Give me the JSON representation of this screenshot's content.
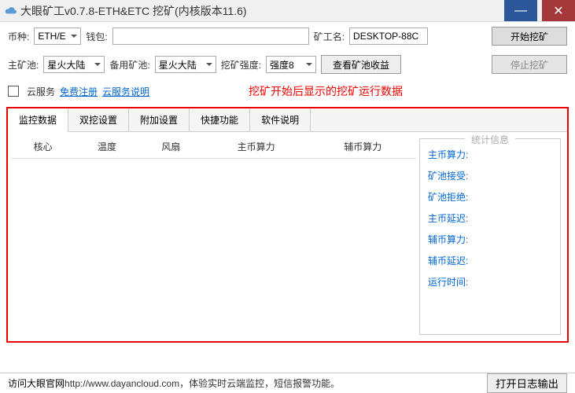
{
  "titlebar": {
    "title": "大眼矿工v0.7.8-ETH&ETC 挖矿(内核版本11.6)"
  },
  "row1": {
    "coin_label": "币种:",
    "coin_value": "ETH/E",
    "wallet_label": "钱包:",
    "wallet_value": "",
    "miner_label": "矿工名:",
    "miner_value": "DESKTOP-88C",
    "start_btn": "开始挖矿"
  },
  "row2": {
    "main_pool_label": "主矿池:",
    "main_pool_value": "星火大陆",
    "backup_pool_label": "备用矿池:",
    "backup_pool_value": "星火大陆",
    "intensity_label": "挖矿强度:",
    "intensity_value": "强度8",
    "view_btn": "查看矿池收益",
    "stop_btn": "停止挖矿"
  },
  "row3": {
    "cloud_label": "云服务",
    "register_link": "免费注册",
    "help_link": "云服务说明",
    "annotation": "挖矿开始后显示的挖矿运行数据"
  },
  "tabs": [
    "监控数据",
    "双挖设置",
    "附加设置",
    "快捷功能",
    "软件说明"
  ],
  "table_headers": [
    "核心",
    "温度",
    "风扇",
    "主币算力",
    "辅币算力"
  ],
  "stats": {
    "title": "统计信息",
    "rows": [
      "主币算力:",
      "矿池接受:",
      "矿池拒绝:",
      "主币延迟:",
      "辅币算力:",
      "辅币延迟:",
      "运行时间:"
    ]
  },
  "footer": {
    "prefix": "访问大眼官网",
    "url": "http://www.dayancloud.com",
    "suffix": "，体验实时云端监控，短信报警功能。",
    "log_btn": "打开日志输出"
  }
}
